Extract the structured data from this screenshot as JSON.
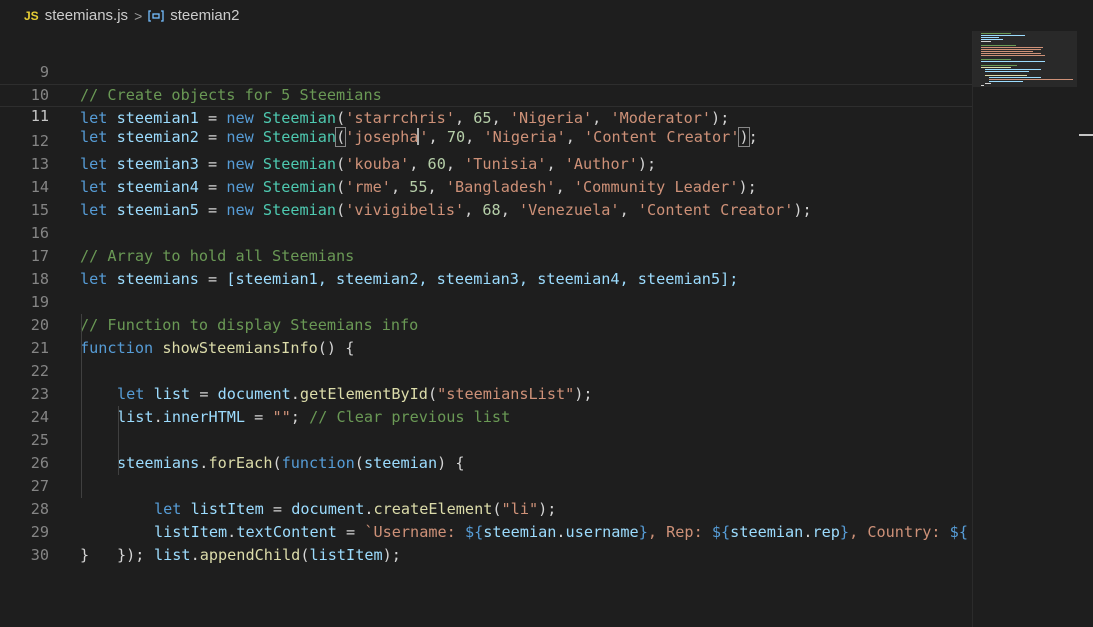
{
  "breadcrumb": {
    "file_badge": "JS",
    "file_name": "steemians.js",
    "separator": ">",
    "symbol_icon": "variable-icon",
    "symbol_name": "steemian2"
  },
  "editor": {
    "language": "javascript",
    "current_line": 11,
    "lines": [
      {
        "n": "9"
      },
      {
        "n": "10"
      },
      {
        "n": "11"
      },
      {
        "n": "12"
      },
      {
        "n": "13"
      },
      {
        "n": "14"
      },
      {
        "n": "15"
      },
      {
        "n": "16"
      },
      {
        "n": "17"
      },
      {
        "n": "18"
      },
      {
        "n": "19"
      },
      {
        "n": "20"
      },
      {
        "n": "21"
      },
      {
        "n": "22"
      },
      {
        "n": "23"
      },
      {
        "n": "24"
      },
      {
        "n": "25"
      },
      {
        "n": "26"
      },
      {
        "n": "27"
      },
      {
        "n": "28"
      },
      {
        "n": "29"
      },
      {
        "n": "30"
      }
    ],
    "tokens": {
      "c9": "// Create objects for 5 Steemians",
      "let": "let",
      "new": "new",
      "Steemian": "Steemian",
      "eq": " = ",
      "s1": "steemian1",
      "s2": "steemian2",
      "s3": "steemian3",
      "s4": "steemian4",
      "s5": "steemian5",
      "u1": "'starrchris'",
      "r1": "65",
      "c1": "'Nigeria'",
      "role1": "'Moderator'",
      "u2a": "'josepha",
      "u2b": "'",
      "r2": "70",
      "c2": "'Nigeria'",
      "role2": "'Content Creator'",
      "u3": "'kouba'",
      "r3": "60",
      "c3": "'Tunisia'",
      "role3": "'Author'",
      "u4": "'rme'",
      "r4": "55",
      "c4": "'Bangladesh'",
      "role4": "'Community Leader'",
      "u5": "'vivigibelis'",
      "r5": "68",
      "c5": "'Venezuela'",
      "role5": "'Content Creator'",
      "c16": "// Array to hold all Steemians",
      "steemians": "steemians",
      "arr": "[steemian1, steemian2, steemian3, steemian4, steemian5];",
      "c19": "// Function to display Steemians info",
      "function": "function",
      "showFn": "showSteemiansInfo",
      "list": "list",
      "document": "document",
      "getById": "getElementById",
      "strList": "\"steemiansList\"",
      "innerHTML": "innerHTML",
      "emptyStr": "\"\"",
      "c22": "// Clear previous list",
      "forEach": "forEach",
      "steemian": "steemian",
      "listItem": "listItem",
      "createEl": "createElement",
      "strLi": "\"li\"",
      "textContent": "textContent",
      "tplStart": "`Username: ",
      "dollarOpen": "${",
      "close": "}",
      "username": "username",
      "tplRep": ", Rep: ",
      "rep": "rep",
      "tplCountry": ", Country: ",
      "appendChild": "appendChild"
    }
  },
  "minimap": {
    "accent_color": "#3794ff"
  }
}
